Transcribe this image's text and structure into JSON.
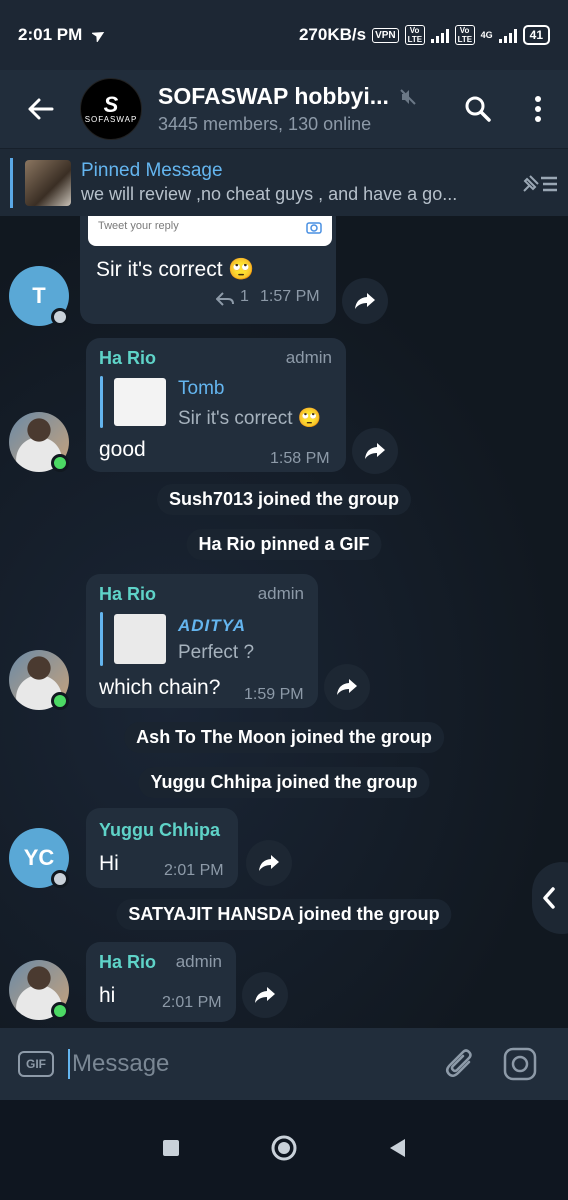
{
  "status_bar": {
    "time": "2:01 PM",
    "speed": "270KB/s",
    "vpn": "VPN",
    "volte1": "Vo LTE",
    "volte2": "Vo LTE",
    "network": "4G",
    "battery": "41"
  },
  "header": {
    "avatar_text": "SOFASWAP",
    "title": "SOFASWAP hobbyi...",
    "subtitle": "3445 members, 130 online"
  },
  "pinned": {
    "label": "Pinned Message",
    "text": "we will review ,no cheat guys , and have a go..."
  },
  "messages": {
    "m1": {
      "avatar_initial": "T",
      "embed_text": "Tweet your reply",
      "text": "Sir it's correct 🙄",
      "reply_count": "1",
      "time": "1:57 PM"
    },
    "m2": {
      "sender": "Ha Rio",
      "role": "admin",
      "reply_name": "Tomb",
      "reply_text": "Sir it's correct 🙄",
      "text": "good",
      "time": "1:58 PM"
    },
    "s1": "Sush7013 joined the group",
    "s2": "Ha Rio pinned a GIF",
    "m3": {
      "sender": "Ha Rio",
      "role": "admin",
      "reply_name": "ADITYA",
      "reply_text": "Perfect ?",
      "text": "which chain?",
      "time": "1:59 PM"
    },
    "s3": "Ash To The Moon joined the group",
    "s4": "Yuggu Chhipa joined the group",
    "m4": {
      "avatar_initial": "YC",
      "sender": "Yuggu Chhipa",
      "text": "Hi",
      "time": "2:01 PM"
    },
    "s5": "SATYAJIT HANSDA joined the group",
    "m5": {
      "sender": "Ha Rio",
      "role": "admin",
      "text": "hi",
      "time": "2:01 PM"
    }
  },
  "composer": {
    "gif_label": "GIF",
    "placeholder": "Message"
  },
  "colors": {
    "accent": "#64b5ef",
    "sender_name": "#5fd3c8",
    "online": "#4cd964",
    "bubble": "#222e3c"
  }
}
